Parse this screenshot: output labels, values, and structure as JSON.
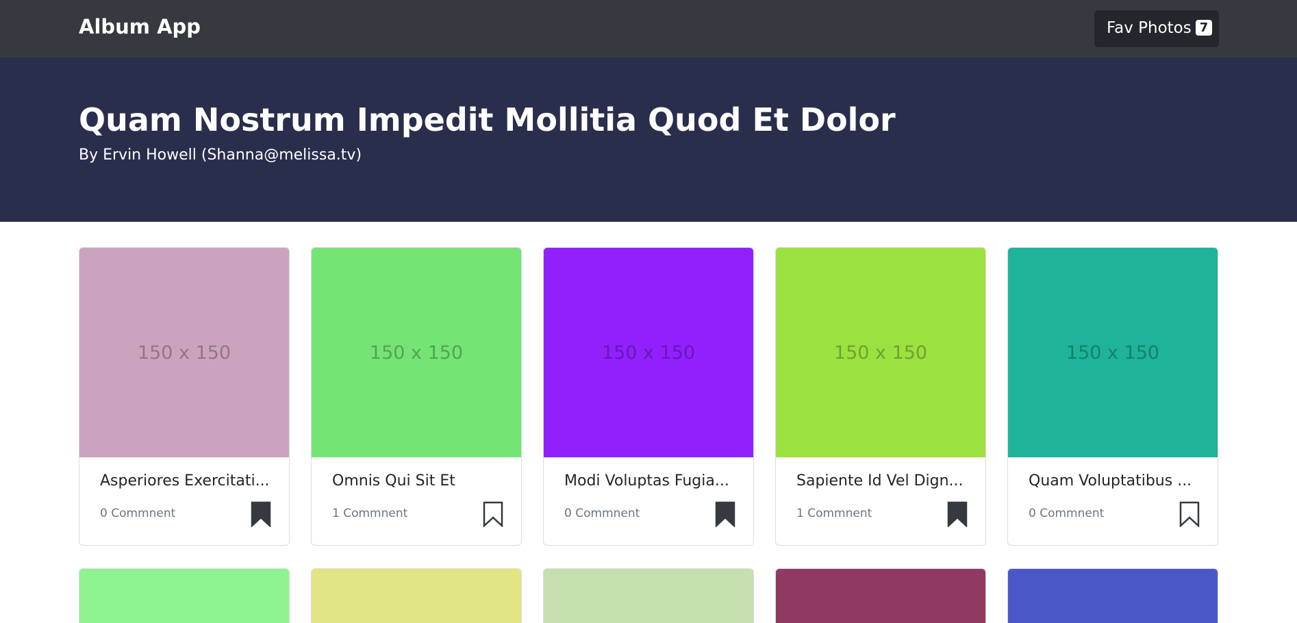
{
  "navbar": {
    "brand": "Album App",
    "fav_label": "Fav Photos",
    "fav_count": "7"
  },
  "hero": {
    "title": "Quam Nostrum Impedit Mollitia Quod Et Dolor",
    "subtitle": "By Ervin Howell (Shanna@melissa.tv)"
  },
  "cards": [
    {
      "title": "Asperiores Exercitati...",
      "comments": "0 Commnent",
      "placeholder": "150 x 150",
      "color": "#cca3be",
      "bookmarked": true
    },
    {
      "title": "Omnis Qui Sit Et",
      "comments": "1 Commnent",
      "placeholder": "150 x 150",
      "color": "#74e474",
      "bookmarked": false
    },
    {
      "title": "Modi Voluptas Fugia...",
      "comments": "0 Commnent",
      "placeholder": "150 x 150",
      "color": "#9120fd",
      "bookmarked": true
    },
    {
      "title": "Sapiente Id Vel Dign...",
      "comments": "1 Commnent",
      "placeholder": "150 x 150",
      "color": "#9be140",
      "bookmarked": true
    },
    {
      "title": "Quam Voluptatibus ...",
      "comments": "0 Commnent",
      "placeholder": "150 x 150",
      "color": "#1eb39a",
      "bookmarked": false
    }
  ],
  "cards_row2": [
    {
      "color": "#8ff48f"
    },
    {
      "color": "#e2e584"
    },
    {
      "color": "#c6e0b0"
    },
    {
      "color": "#903a61"
    },
    {
      "color": "#4a57c7"
    }
  ]
}
